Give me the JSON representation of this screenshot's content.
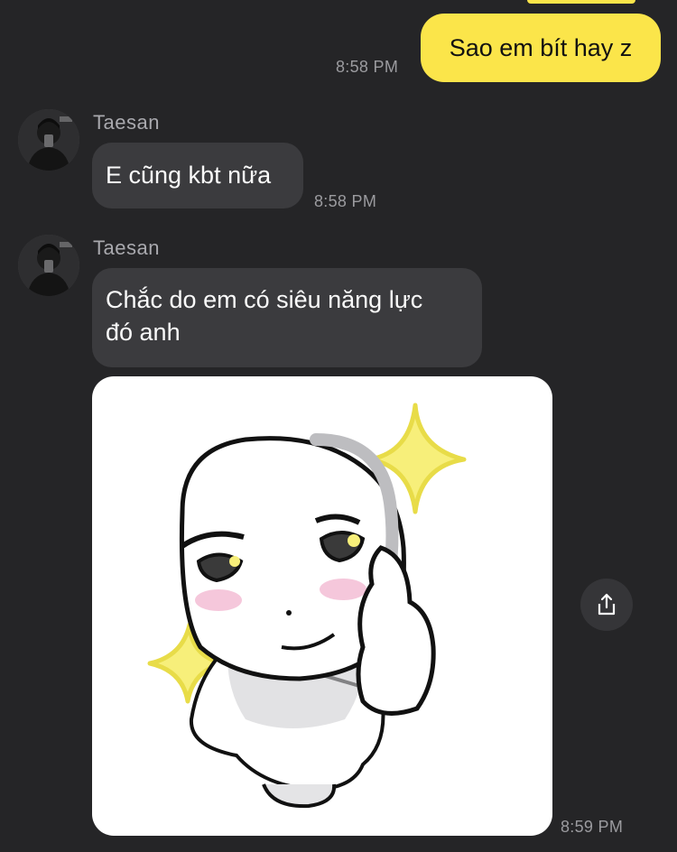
{
  "messages": [
    {
      "type": "outgoing",
      "text": "Sao em bít hay z",
      "time": "8:58 PM"
    },
    {
      "type": "incoming",
      "sender": "Taesan",
      "text": "E cũng kbt nữa",
      "time": "8:58 PM"
    },
    {
      "type": "incoming",
      "sender": "Taesan",
      "text_lines": [
        "Chắc do em có siêu năng lực",
        "đó anh"
      ]
    },
    {
      "type": "incoming-sticker",
      "time": "8:59 PM",
      "icon": "share-icon"
    }
  ],
  "colors": {
    "background": "#252527",
    "incoming_bubble": "#3b3b3e",
    "outgoing_bubble": "#fbe54a",
    "timestamp": "#9b9b9f"
  }
}
